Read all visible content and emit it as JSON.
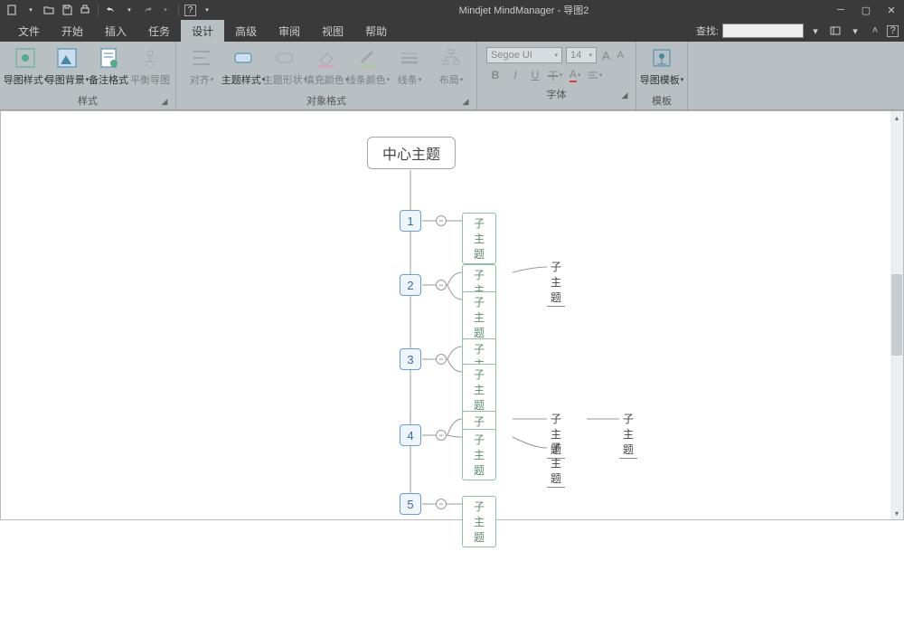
{
  "app": {
    "title": "Mindjet MindManager - 导图2"
  },
  "qat": {
    "new": "□",
    "open": "↷",
    "save": "💾",
    "print": "🖶",
    "undo": "↶",
    "redo": "↷",
    "help": "?"
  },
  "menu": {
    "items": [
      "文件",
      "开始",
      "插入",
      "任务",
      "设计",
      "高级",
      "审阅",
      "视图",
      "帮助"
    ],
    "activeIndex": 4,
    "searchLabel": "查找:",
    "searchPlaceholder": ""
  },
  "ribbon": {
    "groups": [
      {
        "label": "样式",
        "buttons": [
          "导图样式",
          "导图背景",
          "备注格式",
          "平衡导图"
        ]
      },
      {
        "label": "对象格式",
        "buttons": [
          "对齐",
          "主题样式",
          "主题形状",
          "填充颜色",
          "线条颜色",
          "线条",
          "布局"
        ]
      },
      {
        "label": "字体",
        "fontName": "Segoe UI",
        "fontSize": "14"
      },
      {
        "label": "模板",
        "buttons": [
          "导图模板"
        ]
      }
    ]
  },
  "mindmap": {
    "root": "中心主题",
    "mains": [
      "1",
      "2",
      "3",
      "4",
      "5"
    ],
    "sub": "子主题"
  }
}
